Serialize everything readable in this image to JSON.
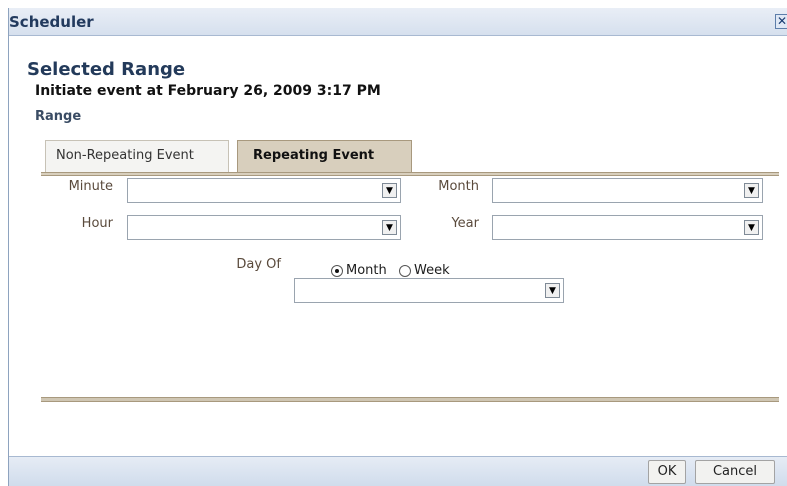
{
  "dialog": {
    "title": "Scheduler",
    "close_glyph": "✕"
  },
  "content": {
    "section_title": "Selected Range",
    "initiate_text": "Initiate event at February 26, 2009 3:17 PM",
    "range_label": "Range"
  },
  "tabs": [
    {
      "label": "Non-Repeating Event",
      "selected": false
    },
    {
      "label": "Repeating Event",
      "selected": true
    }
  ],
  "fields": {
    "minute": {
      "label": "Minute",
      "value": ""
    },
    "hour": {
      "label": "Hour",
      "value": ""
    },
    "month": {
      "label": "Month",
      "value": ""
    },
    "year": {
      "label": "Year",
      "value": ""
    },
    "day_of": {
      "label": "Day Of",
      "options": [
        {
          "label": "Month",
          "checked": true
        },
        {
          "label": "Week",
          "checked": false
        }
      ],
      "value": ""
    }
  },
  "buttons": {
    "ok": "OK",
    "cancel": "Cancel"
  },
  "icons": {
    "dropdown": "▼"
  },
  "colors": {
    "tab_active_bg": "#d8cfbd",
    "titlebar_bg": "#d6e0ee",
    "label_color": "#5a4a3c"
  }
}
